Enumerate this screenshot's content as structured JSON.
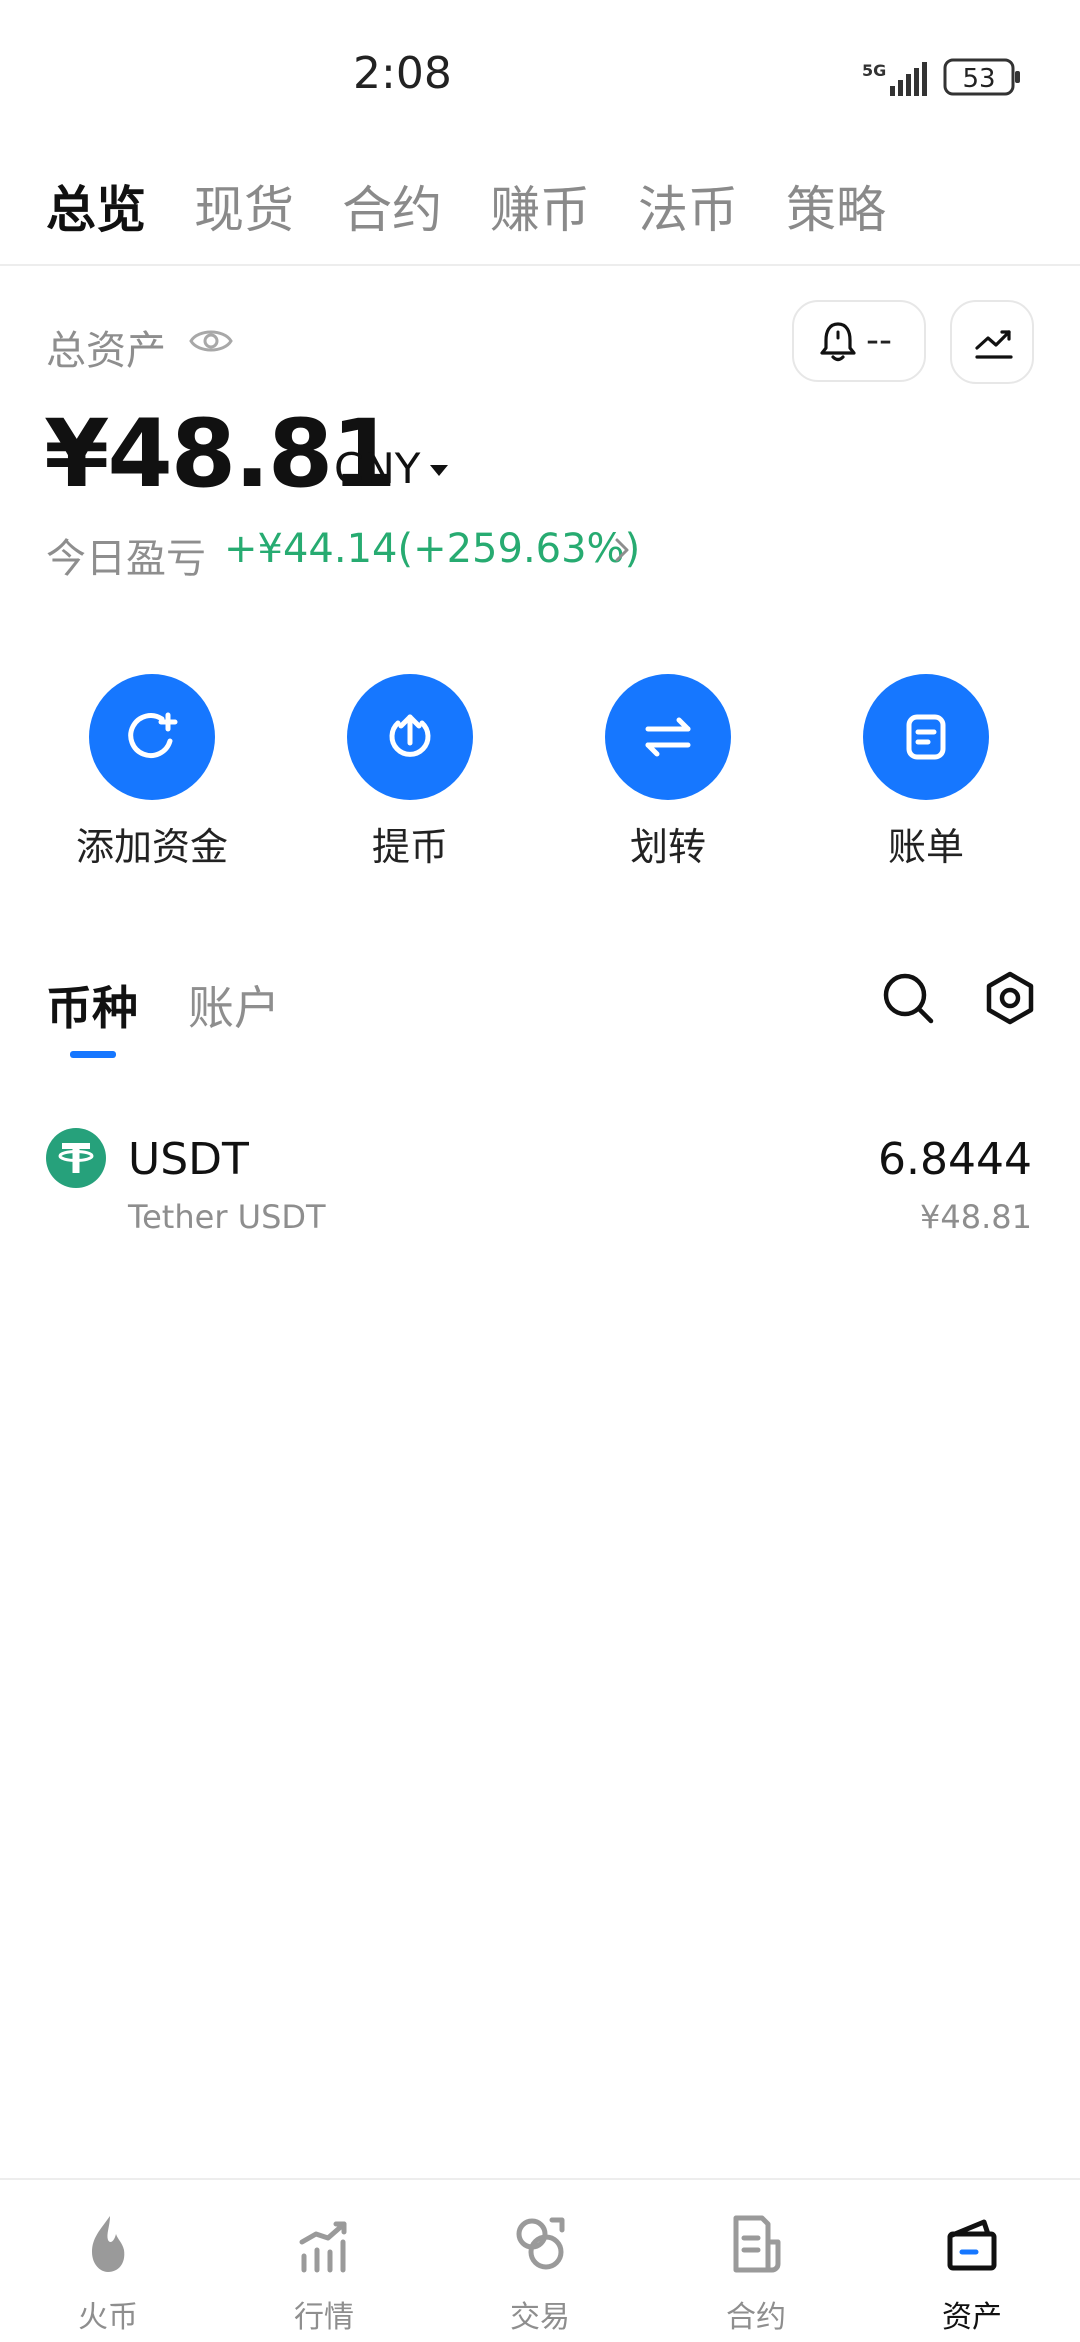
{
  "status_bar": {
    "time": "2:08",
    "network": "5G",
    "battery": "53"
  },
  "top_tabs": [
    {
      "label": "总览",
      "active": true
    },
    {
      "label": "现货",
      "active": false
    },
    {
      "label": "合约",
      "active": false
    },
    {
      "label": "赚币",
      "active": false
    },
    {
      "label": "法币",
      "active": false
    },
    {
      "label": "策略",
      "active": false
    }
  ],
  "overview": {
    "total_label": "总资产",
    "alert_value": "--",
    "total_amount": "¥48.81",
    "currency": "CNY",
    "pnl_label": "今日盈亏",
    "pnl_value": "+¥44.14(+259.63%)"
  },
  "actions": [
    {
      "label": "添加资金",
      "icon": "add-funds-icon"
    },
    {
      "label": "提币",
      "icon": "withdraw-icon"
    },
    {
      "label": "划转",
      "icon": "transfer-icon"
    },
    {
      "label": "账单",
      "icon": "bill-icon"
    }
  ],
  "asset_tabs": {
    "coins": "币种",
    "accounts": "账户"
  },
  "assets": [
    {
      "symbol": "USDT",
      "name": "Tether USDT",
      "amount": "6.8444",
      "value": "¥48.81"
    }
  ],
  "bottom_nav": [
    {
      "label": "火币",
      "icon": "flame-icon",
      "active": false
    },
    {
      "label": "行情",
      "icon": "market-icon",
      "active": false
    },
    {
      "label": "交易",
      "icon": "trade-icon",
      "active": false
    },
    {
      "label": "合约",
      "icon": "contract-icon",
      "active": false
    },
    {
      "label": "资产",
      "icon": "wallet-icon",
      "active": true
    }
  ],
  "colors": {
    "accent": "#1677ff",
    "profit": "#27ab71",
    "usdt": "#26a17b"
  }
}
